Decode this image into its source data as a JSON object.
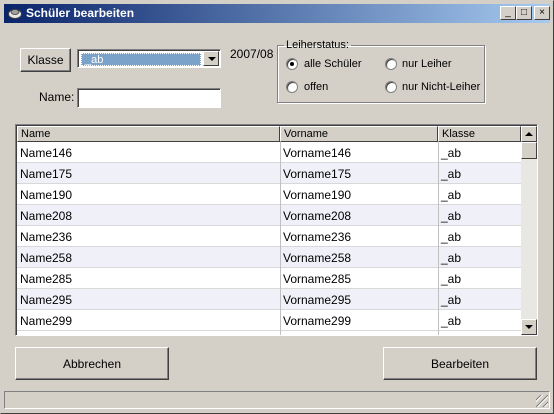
{
  "window": {
    "title": "Schüler bearbeiten",
    "minimize_label": "_",
    "maximize_label": "□",
    "close_label": "×"
  },
  "filter": {
    "klasse_button_label": "Klasse",
    "klasse_selected": "_ab",
    "year_label": "2007/08",
    "name_label": "Name:",
    "name_value": ""
  },
  "leiherstatus": {
    "legend": "Leiherstatus:",
    "options": [
      {
        "label": "alle Schüler",
        "selected": true
      },
      {
        "label": "nur Leiher",
        "selected": false
      },
      {
        "label": "offen",
        "selected": false
      },
      {
        "label": "nur Nicht-Leiher",
        "selected": false
      }
    ]
  },
  "table": {
    "columns": [
      "Name",
      "Vorname",
      "Klasse"
    ],
    "rows": [
      [
        "Name146",
        "Vorname146",
        "_ab"
      ],
      [
        "Name175",
        "Vorname175",
        "_ab"
      ],
      [
        "Name190",
        "Vorname190",
        "_ab"
      ],
      [
        "Name208",
        "Vorname208",
        "_ab"
      ],
      [
        "Name236",
        "Vorname236",
        "_ab"
      ],
      [
        "Name258",
        "Vorname258",
        "_ab"
      ],
      [
        "Name285",
        "Vorname285",
        "_ab"
      ],
      [
        "Name295",
        "Vorname295",
        "_ab"
      ],
      [
        "Name299",
        "Vorname299",
        "_ab"
      ]
    ]
  },
  "actions": {
    "cancel_label": "Abbrechen",
    "edit_label": "Bearbeiten"
  }
}
